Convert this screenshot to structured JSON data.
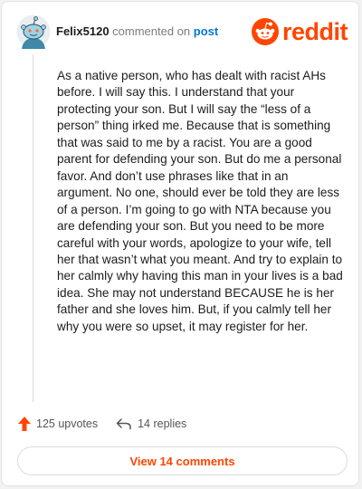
{
  "comment": {
    "username": "Felix5120",
    "action_text": "commented on",
    "post_link_text": "post",
    "body": "As a native person, who has dealt with racist AHs before. I will say this. I understand that your protecting your son. But I will say the “less of a person” thing irked me. Because that is something that was said to me by a racist. You are a good parent for defending your son. But do me a personal favor. And don’t use phrases like that in an argument. No one, should ever be told they are less of a person. I’m going to go with NTA because you are defending your son. But you need to be more careful with your words, apologize to your wife, tell her that wasn’t what you meant. And try to explain to her calmly why having this man in your lives is a bad idea. She may not understand BECAUSE he is her father and she loves him. But, if you calmly tell her why you were so upset, it may register for her.",
    "upvotes_label": "125 upvotes",
    "replies_label": "14 replies",
    "view_comments_label": "View 14 comments"
  },
  "brand": {
    "wordmark": "reddit",
    "color": "#ff4500",
    "icon": "reddit-snoo-icon"
  },
  "icons": {
    "avatar": "snoo-avatar",
    "upvote": "upvote-arrow-icon",
    "reply": "reply-arrow-icon"
  },
  "colors": {
    "accent": "#ff4500",
    "link": "#0079d3",
    "text": "#1c1c1c",
    "muted": "#7c7c7c"
  }
}
